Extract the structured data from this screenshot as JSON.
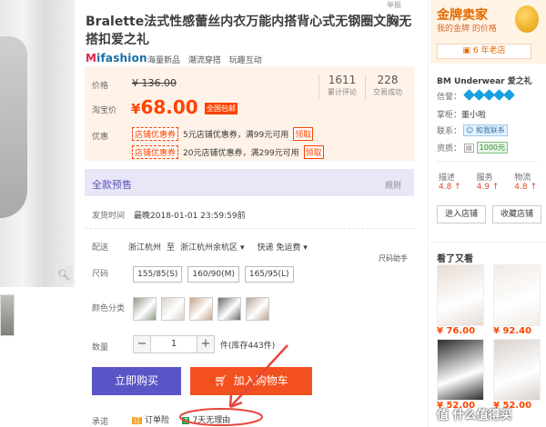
{
  "top_crumb": "举报",
  "product": {
    "title": "Bralette法式性感蕾丝内衣万能内搭背心式无钢圈文胸无搭扣爱之礼",
    "brand_logo": "ifashion",
    "brand_tags": [
      "海量新品",
      "潮流穿搭",
      "玩趣互动"
    ]
  },
  "price": {
    "label_price": "价格",
    "original_price": "¥ 136.00",
    "label_tb": "淘宝价",
    "currency": "¥",
    "current_price": "68.00",
    "shipping_badge": "全国包邮",
    "stats": [
      {
        "value": "1611",
        "label": "累计评论"
      },
      {
        "value": "228",
        "label": "交易成功"
      }
    ],
    "label_discount": "优惠",
    "coupons": [
      {
        "tag": "店铺优惠券",
        "text": "5元店铺优惠券，满99元可用",
        "claim": "领取"
      },
      {
        "tag": "店铺优惠券",
        "text": "20元店铺优惠券，满299元可用",
        "claim": "领取"
      }
    ]
  },
  "presale": {
    "title": "全款预售",
    "rules": "规则",
    "ship_label": "发货时间",
    "ship_value": "最晚2018-01-01 23:59:59前"
  },
  "delivery": {
    "label": "配送",
    "from": "浙江杭州",
    "to_word": "至",
    "to": "浙江杭州余杭区",
    "method": "快递 免运费"
  },
  "size_helper": "尺码助手",
  "sizes": {
    "label": "尺码",
    "options": [
      "155/85(S)",
      "160/90(M)",
      "165/95(L)"
    ]
  },
  "colors": {
    "label": "颜色分类",
    "swatches": [
      "#8f9a85",
      "#d9d4cc",
      "#c9a48a",
      "#6a6a6a",
      "#b9a496"
    ]
  },
  "quantity": {
    "label": "数量",
    "minus": "−",
    "value": "1",
    "plus": "+",
    "stock_text": "件(库存443件)"
  },
  "actions": {
    "buy_now": "立即购买",
    "add_cart": "加入购物车"
  },
  "promise": {
    "label": "承诺",
    "items": [
      {
        "icon": "订",
        "text": "订单险"
      },
      {
        "icon": "7",
        "text": "7天无理由"
      }
    ]
  },
  "shop": {
    "gold_title": "金牌卖家",
    "gold_sub": "我的金牌 的价格",
    "old_store": "6 年老店",
    "name": "BM Underwear 爱之礼",
    "credit_label": "信誉：",
    "owner_label": "掌柜：",
    "owner_value": "董小啦",
    "contact_label": "联系：",
    "contact_tag": "和我联系",
    "qual_label": "资质：",
    "qual_tag": "1000元",
    "scores": [
      {
        "label": "描述",
        "value": "4.8 ↑"
      },
      {
        "label": "服务",
        "value": "4.9 ↑"
      },
      {
        "label": "物流",
        "value": "4.8 ↑"
      }
    ],
    "enter_shop": "进入店铺",
    "fav_shop": "收藏店铺"
  },
  "see_also": {
    "title": "看了又看",
    "items": [
      {
        "price": "¥ 76.00",
        "bg": "#e7dcd4"
      },
      {
        "price": "¥ 92.40",
        "bg": "#f1ebe6"
      },
      {
        "price": "¥ 52.00",
        "bg": "#2c2a2c"
      },
      {
        "price": "¥ 52.00",
        "bg": "#d9d2ce"
      }
    ]
  },
  "watermark": "值 什么值得买"
}
